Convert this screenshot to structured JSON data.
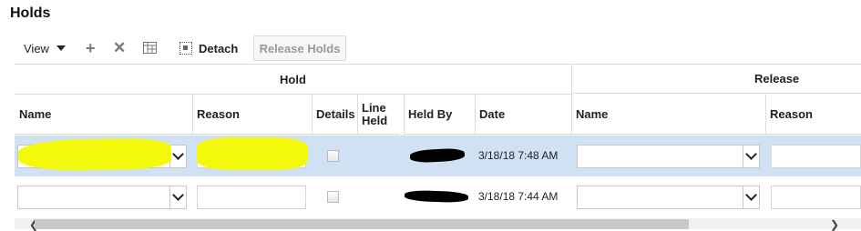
{
  "panel": {
    "title": "Holds"
  },
  "toolbar": {
    "view_label": "View",
    "add_icon": "plus-icon",
    "delete_icon": "x-icon",
    "freeze_icon": "table-freeze-icon",
    "detach_label": "Detach",
    "release_label": "Release Holds"
  },
  "table": {
    "groups": {
      "hold": "Hold",
      "release": "Release"
    },
    "columns": {
      "name": "Name",
      "reason": "Reason",
      "details": "Details",
      "line_held": "Line Held",
      "held_by": "Held By",
      "date": "Date",
      "release_name": "Name",
      "release_reason": "Reason"
    },
    "rows": [
      {
        "date": "3/18/18 7:48 AM",
        "selected": true
      },
      {
        "date": "3/18/18 7:44 AM",
        "selected": false
      }
    ]
  },
  "colors": {
    "selected_row": "#cfe1f2",
    "highlight": "#f4f90a"
  }
}
